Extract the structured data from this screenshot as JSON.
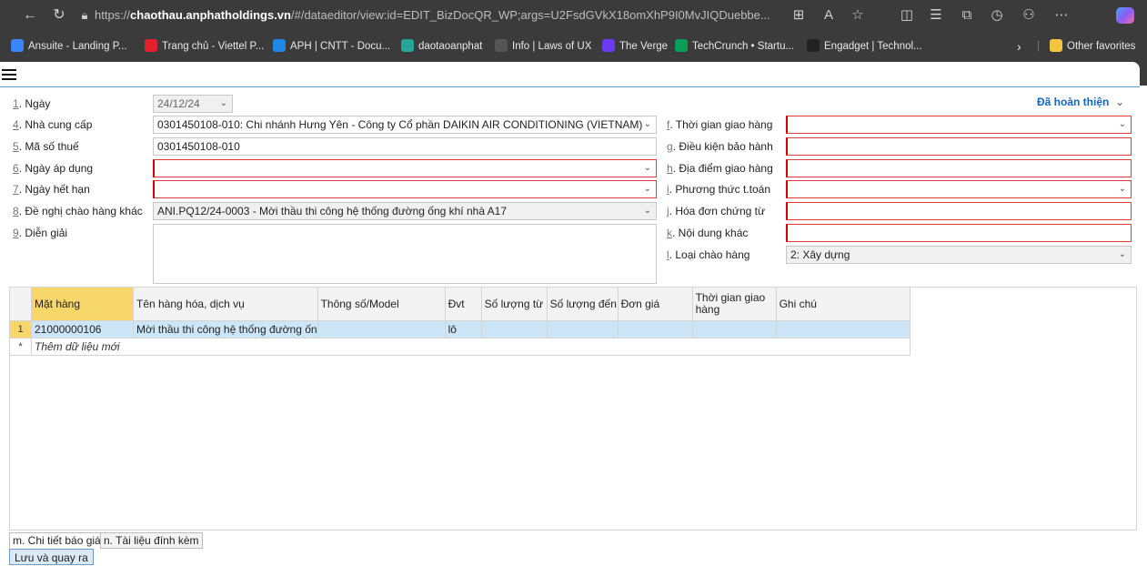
{
  "browser": {
    "url_prefix": "https://",
    "url_domain": "chaothau.anphatholdings.vn",
    "url_rest": "/#/dataeditor/view:id=EDIT_BizDocQR_WP;args=U2FsdGVkX18omXhP9I0MvJIQDuebbe...",
    "bookmarks": [
      {
        "label": "Ansuite - Landing P...",
        "color": "#3a86ff"
      },
      {
        "label": "Trang chủ - Viettel P...",
        "color": "#e5202e"
      },
      {
        "label": "APH | CNTT - Docu...",
        "color": "#1e88e5"
      },
      {
        "label": "daotaoanphat",
        "color": "#26a69a"
      },
      {
        "label": "Info | Laws of UX",
        "color": "#555555"
      },
      {
        "label": "The Verge",
        "color": "#6a3bf2"
      },
      {
        "label": "TechCrunch • Startu...",
        "color": "#0a9d58"
      },
      {
        "label": "Engadget | Technol...",
        "color": "#222222"
      }
    ],
    "other_favorites": "Other favorites"
  },
  "status": "Đã hoàn thiện",
  "form_left": {
    "ngay": {
      "num": "1",
      "label": ". Ngày",
      "value": "24/12/24"
    },
    "nha_cung_cap": {
      "num": "4",
      "label": ". Nhà cung cấp",
      "value": "0301450108-010:  Chi nhánh Hưng Yên - Công ty Cổ phần DAIKIN AIR CONDITIONING (VIETNAM)"
    },
    "ma_so_thue": {
      "num": "5",
      "label": ". Mã số thuế",
      "value": "0301450108-010"
    },
    "ngay_ap_dung": {
      "num": "6",
      "label": ". Ngày áp dụng",
      "value": ""
    },
    "ngay_het_han": {
      "num": "7",
      "label": ". Ngày hết hạn",
      "value": ""
    },
    "de_nghi": {
      "num": "8",
      "label": ". Đề nghị chào hàng khác",
      "value": "ANI.PQ12/24-0003 - Mời thầu thi công hệ thống đường ống khí nhà A17"
    },
    "dien_giai": {
      "num": "9",
      "label": ". Diễn giải",
      "value": ""
    }
  },
  "form_right": {
    "thoi_gian": {
      "num": "f",
      "label": ". Thời gian giao hàng",
      "value": ""
    },
    "dieu_kien": {
      "num": "g",
      "label": ". Điều kiện bảo hành",
      "value": ""
    },
    "dia_diem": {
      "num": "h",
      "label": ". Địa điểm giao hàng",
      "value": ""
    },
    "phuong_thuc": {
      "num": "i",
      "label": ". Phương thức t.toán",
      "value": ""
    },
    "hoa_don": {
      "num": "j",
      "label": ". Hóa đơn chứng từ",
      "value": ""
    },
    "noi_dung": {
      "num": "k",
      "label": ". Nội dung khác",
      "value": ""
    },
    "loai": {
      "num": "l",
      "label": ". Loại chào hàng",
      "value": "2: Xây dựng"
    }
  },
  "grid": {
    "headers": [
      "Mặt hàng",
      "Tên hàng hóa, dịch vụ",
      "Thông số/Model",
      "Đvt",
      "Số lượng từ",
      "Số lượng đến",
      "Đơn giá",
      "Thời gian giao hàng",
      "Ghi chú"
    ],
    "rows": [
      {
        "rn": "1",
        "cells": [
          "21000000106",
          "Mời thầu thi công hệ thống đường ốn",
          "",
          "lô",
          "",
          "",
          "",
          "",
          ""
        ]
      }
    ],
    "add_symbol": "*",
    "add_label": "Thêm dữ liệu mới"
  },
  "tabs": [
    "m. Chi tiết báo giá",
    "n. Tài liệu đính kèm"
  ],
  "save_label": "Lưu và quay ra"
}
